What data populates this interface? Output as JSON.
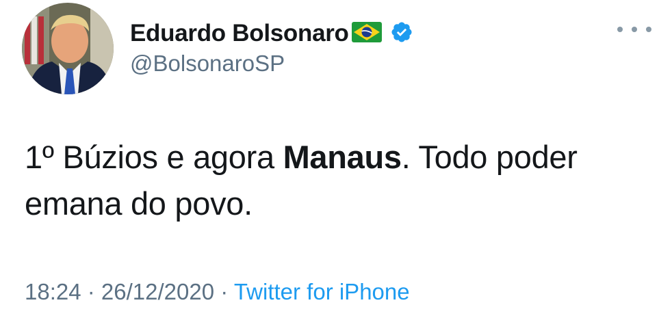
{
  "author": {
    "display_name": "Eduardo Bolsonaro",
    "handle": "@BolsonaroSP",
    "verified": true,
    "flag_icon": "brazil-flag-icon",
    "verified_icon": "verified-badge-icon"
  },
  "tweet": {
    "text_before": "1º Búzios e agora ",
    "text_bold": "Manaus",
    "text_after": ". Todo poder emana do povo."
  },
  "meta": {
    "time": "18:24",
    "separator1": " · ",
    "date": "26/12/2020",
    "separator2": " · ",
    "source": "Twitter for iPhone"
  },
  "colors": {
    "text": "#14171a",
    "secondary": "#5b7083",
    "link": "#1d9bf0",
    "verified": "#1d9bf0"
  }
}
